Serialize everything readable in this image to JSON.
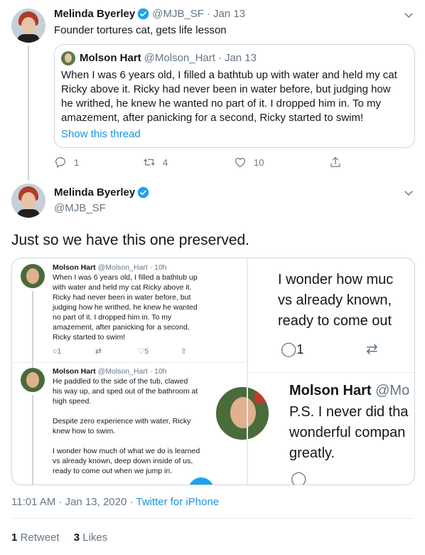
{
  "tweet1": {
    "name": "Melinda Byerley",
    "handle": "@MJB_SF",
    "date": "Jan 13",
    "text": "Founder tortures cat, gets life lesson",
    "quote": {
      "name": "Molson Hart",
      "handle": "@Molson_Hart",
      "date": "Jan 13",
      "lines": [
        "When I was 6 years old, I filled a bathtub up with water and held my cat",
        "Ricky above it. Ricky had never been in water before, but judging how",
        "he writhed, he knew he wanted no part of it. I dropped him in. To my",
        "amazement, after panicking for a second, Ricky started to swim!"
      ],
      "show_thread": "Show this thread"
    },
    "replies": "1",
    "retweets": "4",
    "likes": "10"
  },
  "tweet2": {
    "name": "Melinda Byerley",
    "handle": "@MJB_SF",
    "text": "Just so we have this one preserved.",
    "screenshot": {
      "t1": {
        "name": "Molson Hart",
        "meta": "@Molson_Hart · 10h",
        "lines": [
          "When I was 6 years old, I filled a bathtub up",
          "with water and held my cat Ricky above it.",
          "Ricky had never been in water before, but",
          "judging how he writhed, he knew he wanted",
          "no part of it. I dropped him in. To my",
          "amazement, after panicking for a second,",
          "Ricky started to swim!"
        ],
        "replies": "1",
        "likes": "5"
      },
      "t2": {
        "name": "Molson Hart",
        "meta": "@Molson_Hart · 10h",
        "lines": [
          "He paddled to the side of the tub, clawed",
          "his way up, and sped out of the bathroom at",
          "high speed.",
          "",
          "Despite zero experience with water, Ricky",
          "knew how to swim.",
          "",
          "I wonder how much of what we do is learned",
          "vs already known, deep down inside of us,",
          "ready to come out when we jump in."
        ]
      },
      "right": {
        "lines_top": [
          "I wonder how muc",
          "vs already known,",
          "ready to come out"
        ],
        "replies": "1",
        "name": "Molson Hart",
        "handle": "@Mo",
        "lines_bottom": [
          "P.S. I never did tha",
          "wonderful compan",
          "greatly."
        ]
      }
    },
    "timestamp": "11:01 AM · Jan 13, 2020",
    "source": "Twitter for iPhone",
    "retweet_count": "1",
    "retweet_label": "Retweet",
    "like_count": "3",
    "like_label": "Likes"
  },
  "colors": {
    "accent": "#1b95e0",
    "muted": "#657786",
    "border": "#ccd6dd"
  },
  "icons": [
    "verified-badge-icon",
    "chevron-down-icon",
    "reply-icon",
    "retweet-icon",
    "like-icon",
    "share-icon"
  ]
}
